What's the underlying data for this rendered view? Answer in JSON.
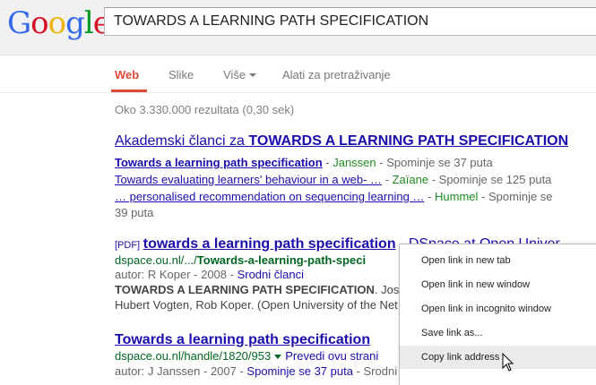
{
  "logo": {
    "letters": [
      "G",
      "o",
      "o",
      "g",
      "l",
      "e"
    ],
    "colors": [
      "#3369e8",
      "#d50f25",
      "#eeb211",
      "#3369e8",
      "#009925",
      "#d50f25"
    ]
  },
  "search": {
    "value": "TOWARDS A LEARNING PATH SPECIFICATION"
  },
  "tabs": [
    {
      "label": "Web",
      "active": true
    },
    {
      "label": "Slike",
      "active": false
    },
    {
      "label": "Više",
      "active": false
    },
    {
      "label": "Alati za pretraživanje",
      "active": false
    }
  ],
  "stats": "Oko 3.330.000 rezultata (0,30 sek)",
  "scholar": {
    "title_prefix": "Akademski članci za ",
    "title_bold": "TOWARDS A LEARNING PATH SPECIFICATION",
    "items": [
      {
        "link": "Towards a learning path specification",
        "author": "Janssen",
        "cites": "Spominje se 37 puta"
      },
      {
        "link": "Towards evaluating learners' behaviour in a web- …",
        "author": "Zaïane",
        "cites": "Spominje se 125 puta"
      },
      {
        "link": "… personalised recommendation on sequencing learning …",
        "author": "Hummel",
        "cites": "Spominje se",
        "cites2": "39 puta"
      }
    ]
  },
  "result1": {
    "pdf": "[PDF]",
    "title": "towards a learning path specification",
    "title_rest": " - DSpace at Open Univer",
    "url_prefix": "dspace.ou.nl/.../",
    "url_bold": "Towards-a-learning-path-speci",
    "meta_prefix": "autor: R Koper - 2008 - ",
    "meta_link": "Srodni članci",
    "snippet1_bold": "TOWARDS A LEARNING PATH SPECIFICATION",
    "snippet1_rest": ". Jos",
    "snippet2": "Hubert Vogten, Rob Koper. (Open University of the Net"
  },
  "result2": {
    "title": "Towards a learning path specification",
    "url": "dspace.ou.nl/handle/1820/953",
    "translate": "Prevedi ovu strani",
    "meta_prefix": "autor: J Janssen - 2007 - ",
    "meta_cites": "Spominje se 37 puta",
    "meta_rest": " - Srodni"
  },
  "context_menu": {
    "items": [
      "Open link in new tab",
      "Open link in new window",
      "Open link in incognito window",
      "Save link as...",
      "Copy link address"
    ],
    "highlighted_index": 4
  }
}
